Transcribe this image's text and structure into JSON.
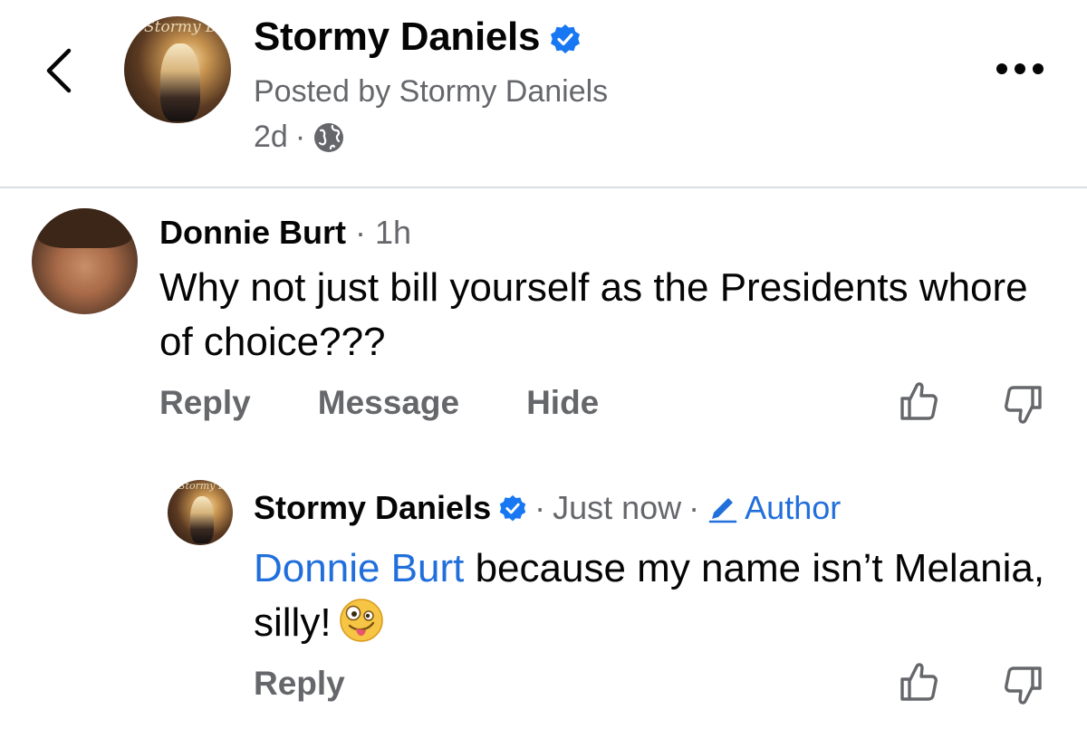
{
  "header": {
    "name": "Stormy Daniels",
    "posted_by": "Posted by Stormy Daniels",
    "time": "2d",
    "separator": "·",
    "avatar_script": "Stormy Dani"
  },
  "comment": {
    "author": "Donnie Burt",
    "time": " · 1h",
    "text": "Why not just bill yourself as the Presidents whore of choice???",
    "actions": {
      "reply": "Reply",
      "message": "Message",
      "hide": "Hide"
    }
  },
  "reply": {
    "author": "Stormy Daniels",
    "dot1": "·",
    "time": "Just now",
    "dot2": "·",
    "role": "Author",
    "mention": "Donnie Burt",
    "text": " because my name isn’t Melania, silly!",
    "action_reply": "Reply",
    "avatar_script": "Stormy Dani"
  },
  "icons": {
    "back": "chevron-left-icon",
    "more": "more-horizontal-icon",
    "verified": "verified-badge-icon",
    "privacy": "globe-icon",
    "like": "thumbs-up-icon",
    "dislike": "thumbs-down-icon",
    "author_badge": "pencil-icon",
    "emoji": "zany-face-icon"
  },
  "colors": {
    "accent_blue": "#216fdb",
    "verified_blue": "#1877f2",
    "secondary_text": "#65676b",
    "primary_text": "#050505",
    "divider": "#dadde1"
  }
}
